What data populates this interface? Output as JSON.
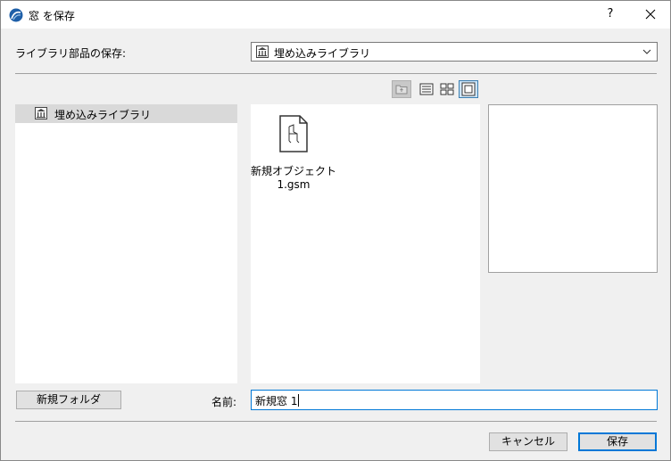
{
  "window": {
    "title": "窓 を保存",
    "help_label": "?",
    "close_icon": "close-icon",
    "app_icon": "archicad-icon"
  },
  "location": {
    "label": "ライブラリ部品の保存:",
    "selected": "埋め込みライブラリ",
    "icon": "library-building-icon"
  },
  "view_toolbar": {
    "buttons": [
      {
        "name": "up-folder-icon",
        "state": "disabled"
      },
      {
        "name": "list-view-icon",
        "state": "normal"
      },
      {
        "name": "grid-view-icon",
        "state": "normal"
      },
      {
        "name": "preview-view-icon",
        "state": "active"
      }
    ]
  },
  "tree": {
    "items": [
      {
        "label": "埋め込みライブラリ",
        "icon": "library-building-icon",
        "selected": true
      }
    ]
  },
  "files": {
    "items": [
      {
        "name_line1": "新規オブジェクト",
        "name_line2": "1.gsm",
        "icon": "gsm-object-file-icon"
      }
    ]
  },
  "name_field": {
    "label": "名前:",
    "value": "新規窓 1"
  },
  "buttons": {
    "new_folder": "新規フォルダ",
    "cancel": "キャンセル",
    "save": "保存"
  },
  "colors": {
    "accent": "#0078d7",
    "selection": "#d9d9d9",
    "active_toggle": "#cce4f7"
  }
}
